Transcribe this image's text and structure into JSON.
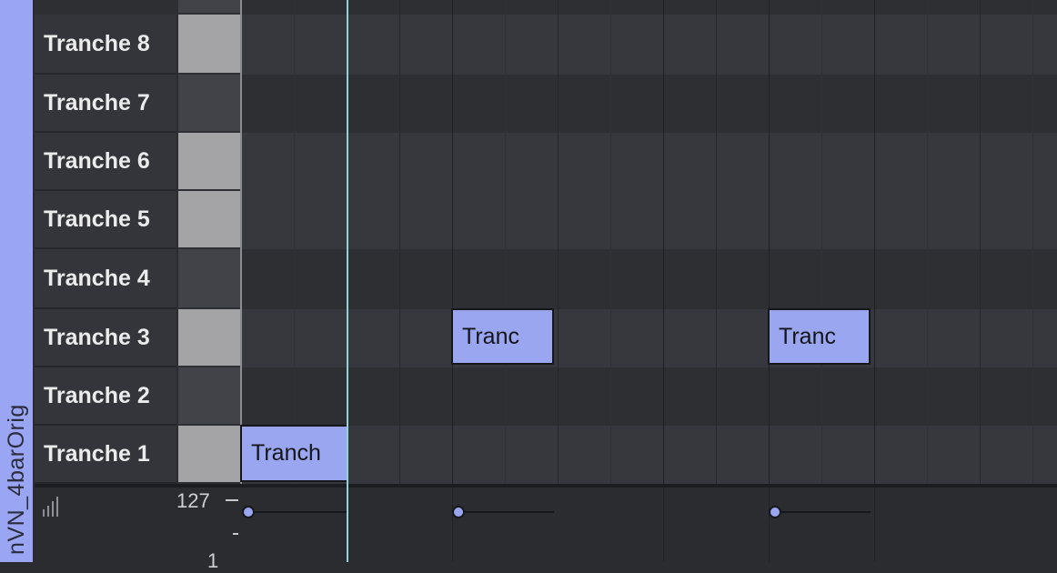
{
  "clip": {
    "name": "nVN_4barOrig"
  },
  "lanes": [
    {
      "label": "Tranche 8"
    },
    {
      "label": "Tranche 7"
    },
    {
      "label": "Tranche 6"
    },
    {
      "label": "Tranche 5"
    },
    {
      "label": "Tranche 4"
    },
    {
      "label": "Tranche 3"
    },
    {
      "label": "Tranche 2"
    },
    {
      "label": "Tranche 1"
    }
  ],
  "notes": [
    {
      "label": "Tranch",
      "lane": "Tranche 1"
    },
    {
      "label": "Tranc",
      "lane": "Tranche 3"
    },
    {
      "label": "Tranc",
      "lane": "Tranche 3"
    }
  ],
  "velocity": {
    "max_label": "127",
    "min_label": "1",
    "icon": "velocity-bars-icon"
  },
  "colors": {
    "note": "#9aa6f0",
    "playhead": "#8fd3dd",
    "clip_strip": "#9aa6f4"
  }
}
